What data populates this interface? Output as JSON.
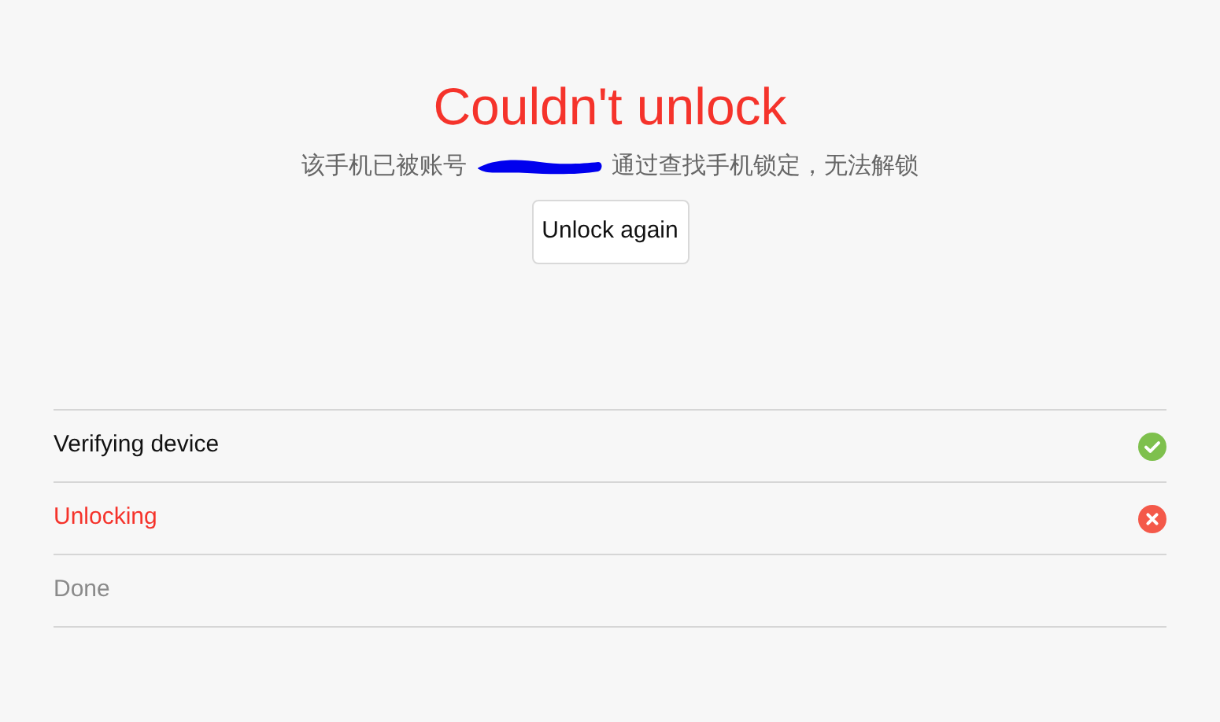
{
  "title": "Couldn't unlock",
  "message": {
    "before": "该手机已被账号",
    "after": "通过查找手机锁定，无法解锁"
  },
  "action_button": "Unlock again",
  "steps": [
    {
      "label": "Verifying device",
      "kind": "done"
    },
    {
      "label": "Unlocking",
      "kind": "failed"
    },
    {
      "label": "Done",
      "kind": "pending"
    }
  ]
}
